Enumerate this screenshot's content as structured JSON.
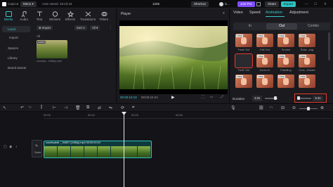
{
  "titlebar": {
    "app_name": "CapCut",
    "menu_label": "Menu",
    "autosave": "Auto saved: 15:23:44",
    "project_id": "1225",
    "shortcut_label": "Shortcut",
    "user_label": "C...",
    "join_pro_label": "Join Pro",
    "share_label": "Share",
    "export_label": "Export"
  },
  "tool_tabs": [
    {
      "label": "Media",
      "icon": "media-icon"
    },
    {
      "label": "Audio",
      "icon": "audio-icon"
    },
    {
      "label": "Text",
      "icon": "text-icon"
    },
    {
      "label": "Stickers",
      "icon": "stickers-icon"
    },
    {
      "label": "Effects",
      "icon": "effects-icon"
    },
    {
      "label": "Transitions",
      "icon": "transitions-icon"
    },
    {
      "label": "Filters",
      "icon": "filters-icon"
    }
  ],
  "left_nav": [
    "Local",
    "Import",
    "Spaces",
    "Library",
    "Brand assets"
  ],
  "media": {
    "import_label": "Import",
    "sort_label": "Sort",
    "all_label": "All",
    "filter_all": "All",
    "clip_badge": "Added",
    "clip_name": "countrys...1080p).mp4"
  },
  "player": {
    "title": "Player",
    "time_current": "00:00:18:10",
    "time_total": "00:00:24:24"
  },
  "right_panel": {
    "tabs": [
      "Video",
      "Speed",
      "Animation",
      "Adjustment"
    ],
    "segments": [
      "In",
      "Out",
      "Combo"
    ],
    "effects": [
      {
        "label": "Fade Out",
        "badge": "FREE",
        "selected": false
      },
      {
        "label": "Fall Out",
        "badge": "FREE",
        "selected": false
      },
      {
        "label": "Smoke",
        "badge": "FREE",
        "selected": false
      },
      {
        "label": "Rota...ang",
        "badge": "FREE",
        "selected": false
      },
      {
        "label": "Fade Out",
        "badge": "",
        "selected": true
      },
      {
        "label": "Zoom In",
        "badge": "FREE",
        "selected": false
      },
      {
        "label": "Paddling",
        "badge": "FREE",
        "selected": false
      },
      {
        "label": "Cros...Rotate",
        "badge": "FREE",
        "selected": false
      },
      {
        "label": "",
        "badge": "FREE",
        "selected": false
      },
      {
        "label": "",
        "badge": "FREE",
        "selected": false
      },
      {
        "label": "",
        "badge": "FREE",
        "selected": false
      },
      {
        "label": "",
        "badge": "FREE",
        "selected": false
      }
    ],
    "duration_label": "Duration",
    "duration_value": "4.0s",
    "speed_value": "6.4s"
  },
  "timeline": {
    "ticks": [
      "00:00",
      "00:10",
      "00:20",
      "00:30"
    ],
    "cover_label": "Cover",
    "clip_title": "countryside _ 54837 (1080p).mp4  00:00:24:24"
  },
  "colors": {
    "accent": "#39c7c9",
    "highlight": "#e23a2e",
    "export": "#2ec1c3"
  }
}
